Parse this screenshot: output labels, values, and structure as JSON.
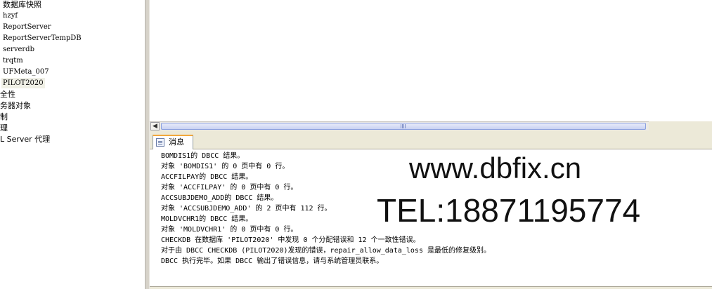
{
  "explorer": {
    "section_title": "数据库快照",
    "databases": [
      "hzyf",
      "ReportServer",
      "ReportServerTempDB",
      "serverdb",
      "trqtm",
      "UFMeta_007",
      "PILOT2020"
    ],
    "selected_database": "PILOT2020",
    "nodes": [
      "全性",
      "务器对象",
      "制",
      "理",
      "L Server 代理"
    ]
  },
  "results": {
    "tab_label": "消息",
    "messages": [
      "BOMDIS1的 DBCC 结果。",
      "对象 'BOMDIS1' 的 0 页中有 0 行。",
      "ACCFILPAY的 DBCC 结果。",
      "对象 'ACCFILPAY' 的 0 页中有 0 行。",
      "ACCSUBJDEMO_ADD的 DBCC 结果。",
      "对象 'ACCSUBJDEMO_ADD' 的 2 页中有 112 行。",
      "MOLDVCHR1的 DBCC 结果。",
      "对象 'MOLDVCHR1' 的 0 页中有 0 行。",
      "CHECKDB 在数据库 'PILOT2020' 中发现 0 个分配错误和 12 个一致性错误。",
      "对于由 DBCC CHECKDB (PILOT2020)发现的错误，repair_allow_data_loss 是最低的修复级别。",
      "DBCC 执行完毕。如果 DBCC 输出了错误信息，请与系统管理员联系。"
    ]
  },
  "watermark": {
    "url": "www.dbfix.cn",
    "tel": "TEL:18871195774"
  },
  "icons": {
    "scroll_left": "chevron-left-icon",
    "message_tab": "message-icon"
  }
}
